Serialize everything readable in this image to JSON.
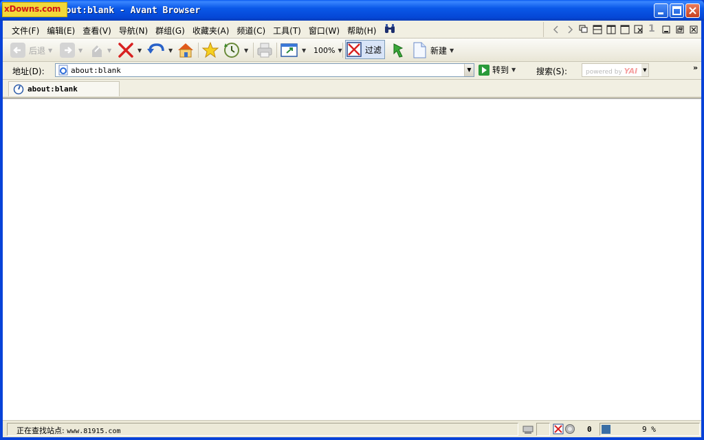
{
  "window": {
    "title": "about:blank - Avant Browser",
    "watermark": "xDowns.com"
  },
  "menu": {
    "items": [
      "文件(F)",
      "编辑(E)",
      "查看(V)",
      "导航(N)",
      "群组(G)",
      "收藏夹(A)",
      "频道(C)",
      "工具(T)",
      "窗口(W)",
      "帮助(H)"
    ]
  },
  "mdi": {
    "number": "1"
  },
  "toolbar": {
    "back_label": "后退",
    "zoom_label": "100%",
    "filter_label": "过滤",
    "new_label": "新建"
  },
  "address": {
    "label": "地址(D):",
    "value": "about:blank",
    "go_label": "转到",
    "search_label": "搜索(S):",
    "search_placeholder": "powered by",
    "search_brand": "YAI",
    "more": "»"
  },
  "tabs": [
    {
      "label": "about:blank"
    }
  ],
  "status": {
    "prefix": "正在查找站点:",
    "url": "www.81915.com",
    "count": "0",
    "progress_percent": 9,
    "progress_text": "9 %"
  },
  "colors": {
    "titlebar": "#0547d6",
    "accent": "#3a6ea5",
    "close_button": "#c8401e"
  }
}
